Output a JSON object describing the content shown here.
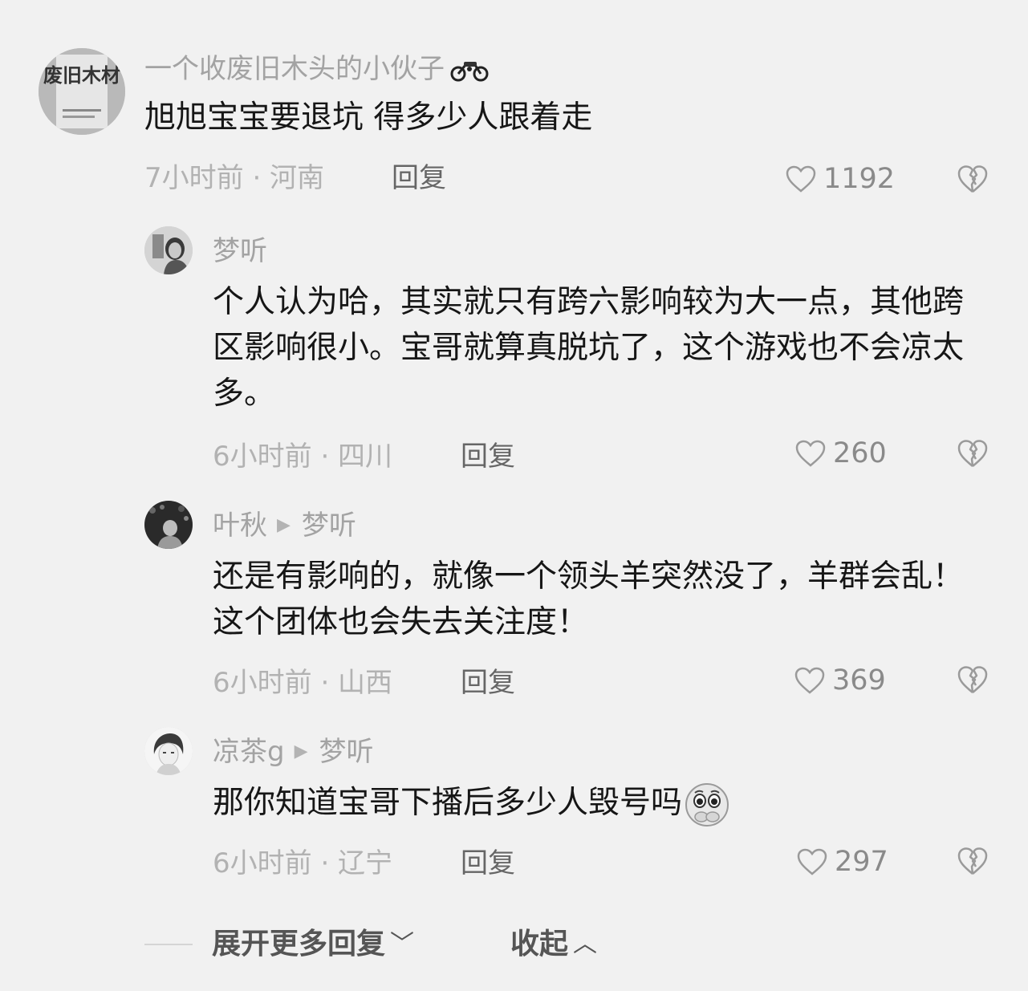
{
  "comments": [
    {
      "author": "一个收废旧木头的小伙子",
      "author_badge": "motorcycle-icon",
      "avatar_text": "废旧木材",
      "text": "旭旭宝宝要退坑 得多少人跟着走",
      "meta": "7小时前 · 河南",
      "reply_label": "回复",
      "likes": "1192"
    },
    {
      "author": "梦听",
      "text": "个人认为哈，其实就只有跨六影响较为大一点，其他跨区影响很小。宝哥就算真脱坑了，这个游戏也不会凉太多。",
      "meta": "6小时前 · 四川",
      "reply_label": "回复",
      "likes": "260"
    },
    {
      "author": "叶秋",
      "reply_to": "梦听",
      "text": "还是有影响的，就像一个领头羊突然没了，羊群会乱！这个团体也会失去关注度！",
      "meta": "6小时前 · 山西",
      "reply_label": "回复",
      "likes": "369"
    },
    {
      "author": "凉茶g",
      "reply_to": "梦听",
      "text": "那你知道宝哥下播后多少人毁号吗",
      "text_emoji": "pleading-face-emoji",
      "meta": "6小时前 · 辽宁",
      "reply_label": "回复",
      "likes": "297"
    }
  ],
  "footer": {
    "expand_label": "展开更多回复",
    "collapse_label": "收起"
  },
  "colors": {
    "background": "#f1f1f1",
    "text": "#161616",
    "muted": "#a3a3a3"
  }
}
